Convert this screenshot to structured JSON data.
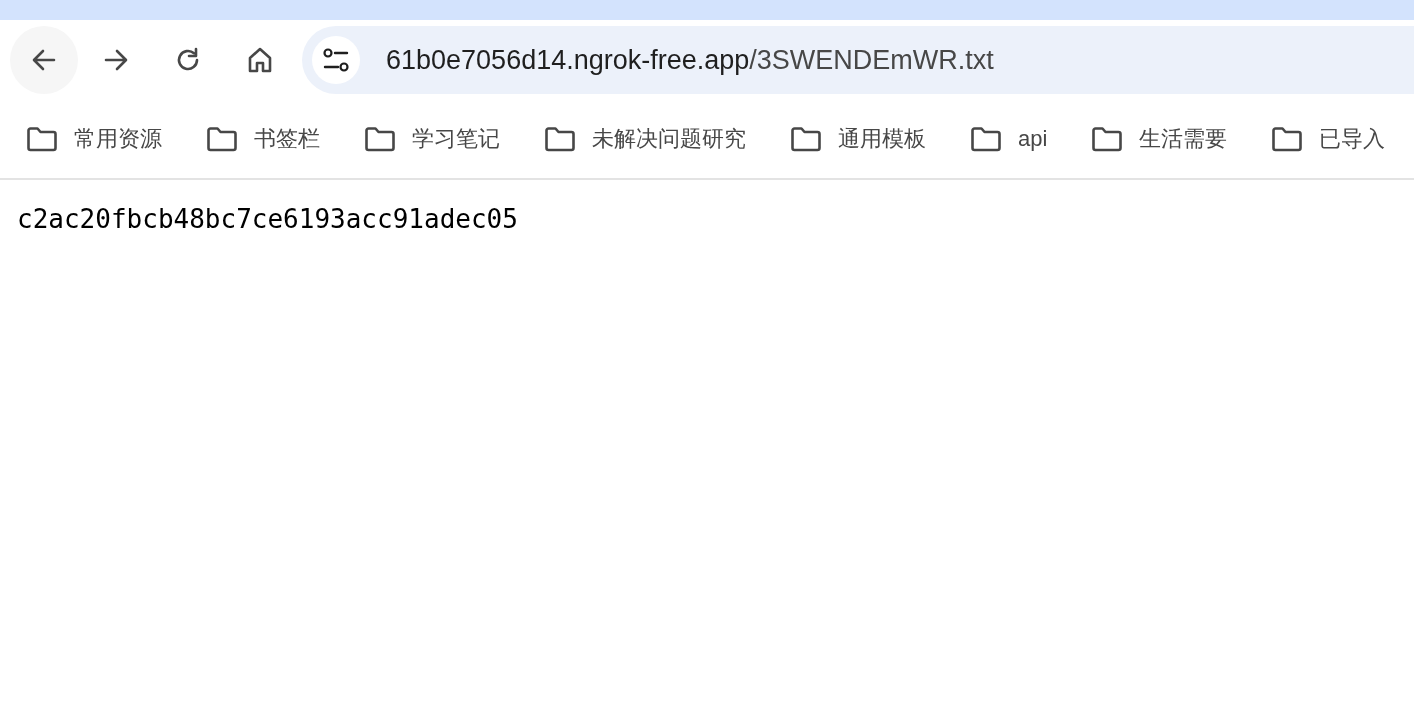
{
  "address_bar": {
    "host": "61b0e7056d14.ngrok-free.app",
    "path": "/3SWENDEmWR.txt"
  },
  "bookmarks": [
    {
      "label": "常用资源"
    },
    {
      "label": "书签栏"
    },
    {
      "label": "学习笔记"
    },
    {
      "label": "未解决问题研究"
    },
    {
      "label": "通用模板"
    },
    {
      "label": "api"
    },
    {
      "label": "生活需要"
    },
    {
      "label": "已导入"
    }
  ],
  "document": {
    "text": "c2ac20fbcb48bc7ce6193acc91adec05"
  }
}
